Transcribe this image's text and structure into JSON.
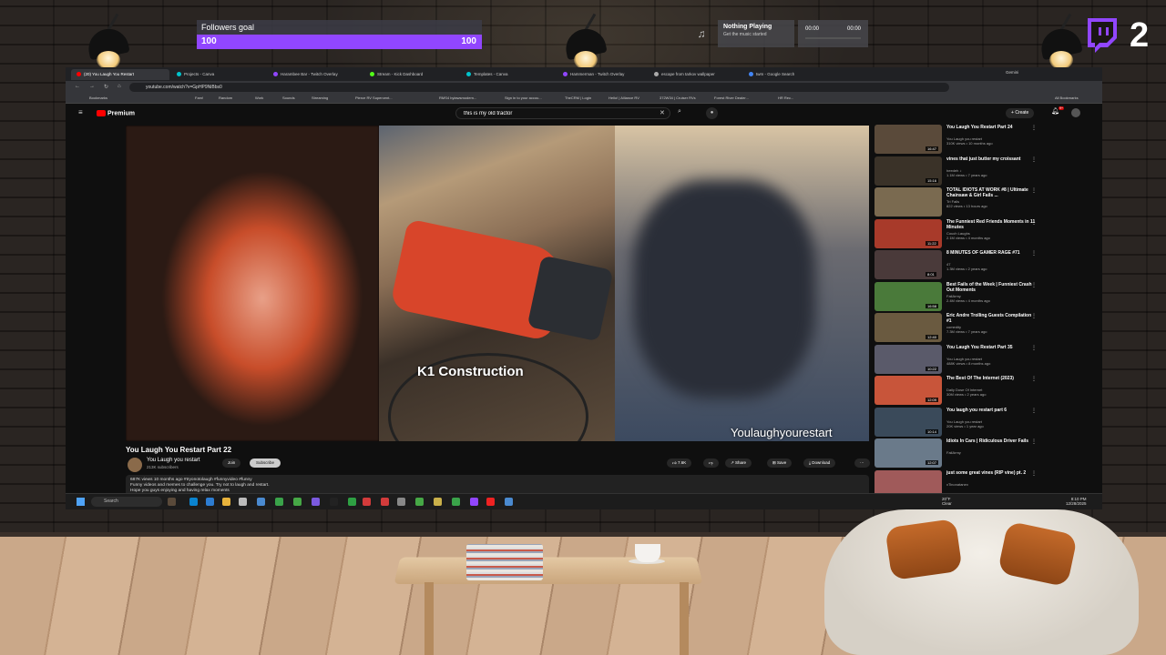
{
  "overlay": {
    "followers_goal": {
      "label": "Followers goal",
      "current": "100",
      "target": "100",
      "progress": 1.0
    },
    "music": {
      "title": "Nothing Playing",
      "subtitle": "Get the music started",
      "elapsed": "00:00",
      "total": "00:00"
    },
    "twitch_count": "2",
    "colors": {
      "goal_fill": "#9146ff",
      "twitch_purple": "#9146ff"
    }
  },
  "browser": {
    "tabs": [
      "(20) You Laugh You Restart",
      "Projects - Canva",
      "Harambee Bar - Twitch Overlay",
      "Stream - Kick Dashboard",
      "Templates - Canva",
      "Hammerman - Twitch Overlay",
      "escape from tarkov wallpaper",
      "twm - Google Search"
    ],
    "gemini": "Gemini",
    "address": "youtube.com/watch?v=GpHP9NiBbs0",
    "bookmarks": [
      "Bookmarks",
      "Fam!",
      "Random",
      "Work",
      "Sounds",
      "Streaming",
      "Pierce RV Supercent...",
      "RMS4 bylawsmodern...",
      "Sign in to your accou...",
      "TheCRM | Login",
      "Hello! | Alliance RV",
      "372W34 | Cruiser RVs",
      "Forest River Dealer...",
      "HR Rec...",
      "All Bookmarks"
    ]
  },
  "youtube": {
    "logo": "Premium",
    "search_value": "this is my old tractor",
    "create_label": "Create",
    "notif_badge": "9+",
    "caption": "K1 Construction",
    "watermark": "Youlaughyourestart",
    "video_title": "You Laugh You Restart Part 22",
    "channel": "You Laugh you restart",
    "subscribers": "213K subscribers",
    "join": "Join",
    "subscribe": "Subscribe",
    "likes": "7.6K",
    "share": "Share",
    "save": "Save",
    "download": "Download",
    "description": [
      "687K views  10 months ago  #tryonotolaugh #funnyvideo #funny",
      "Funny videos and memes to challenge you. Try not to laugh and restart.",
      "Hope you guys enjoying and having relax moments"
    ],
    "recommendations": [
      {
        "title": "You Laugh You Restart Part 24",
        "channel": "You Laugh you restart",
        "meta": "310K views • 10 months ago",
        "duration": "16:47",
        "color": "#5a4a3a"
      },
      {
        "title": "vines that just butter my croissant",
        "channel": "heedeh ♪",
        "meta": "1.1M views • 7 years ago",
        "duration": "15:16",
        "color": "#3a3228"
      },
      {
        "title": "TOTAL IDIOTS AT WORK #8 | Ultimate Chainsaw & Girl Fails ...",
        "channel": "Tri Fails",
        "meta": "822 views • 13 hours ago",
        "duration": "",
        "color": "#7a6a50"
      },
      {
        "title": "The Funniest Red Friends Moments in 11 Minutes",
        "channel": "Couch Laughs",
        "meta": "2.1M views • 4 months ago",
        "duration": "11:22",
        "color": "#a83a2a"
      },
      {
        "title": "8 MINUTES OF GAMER RAGE #71",
        "channel": "47",
        "meta": "1.3M views • 2 years ago",
        "duration": "8:01",
        "color": "#4a3a3a"
      },
      {
        "title": "Best Fails of the Week | Funniest Crash Out Moments",
        "channel": "FailArmy",
        "meta": "2.4M views • 4 months ago",
        "duration": "16:58",
        "color": "#4a7a3a"
      },
      {
        "title": "Eric Andre Trolling Guests Compilation #1",
        "channel": "comedity",
        "meta": "7.3M views • 7 years ago",
        "duration": "12:40",
        "color": "#6a5a40"
      },
      {
        "title": "You Laugh You Restart Part 35",
        "channel": "You Laugh you restart",
        "meta": "488K views • 8 months ago",
        "duration": "10:22",
        "color": "#5a5a6a"
      },
      {
        "title": "The Best Of The Internet (2023)",
        "channel": "Daily Dose Of Internet",
        "meta": "30M views • 2 years ago",
        "duration": "12:09",
        "color": "#c8553a"
      },
      {
        "title": "You laugh you restart part 6",
        "channel": "You Laugh you restart",
        "meta": "20K views • 1 year ago",
        "duration": "10:14",
        "color": "#3a4a5a"
      },
      {
        "title": "Idiots In Cars | Ridiculous Driver Fails",
        "channel": "FailArmy",
        "meta": "",
        "duration": "12:07",
        "color": "#6a7a8a"
      },
      {
        "title": "just some great vines (RIP vine) pt. 2",
        "channel": "xTinonatanex",
        "meta": "",
        "duration": "",
        "color": "#a05a5a"
      }
    ]
  },
  "taskbar": {
    "search": "Search",
    "weather_temp": "20°F",
    "weather_cond": "Clear",
    "time": "8:10 PM",
    "date": "12/28/2025"
  }
}
